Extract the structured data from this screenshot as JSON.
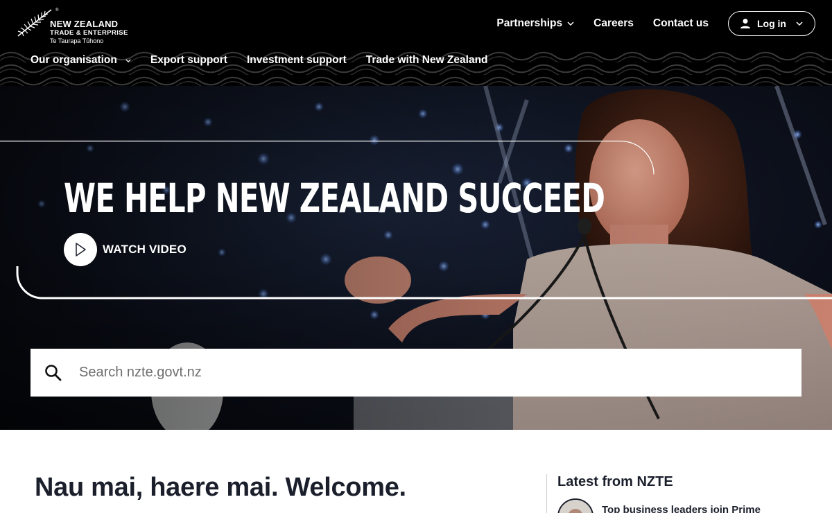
{
  "header": {
    "logo": {
      "line1": "NEW ZEALAND",
      "line2": "TRADE & ENTERPRISE",
      "line3": "Te Taurapa Tūhono",
      "registered": "®"
    },
    "top_nav": [
      {
        "label": "Partnerships",
        "has_dropdown": true
      },
      {
        "label": "Careers",
        "has_dropdown": false
      },
      {
        "label": "Contact us",
        "has_dropdown": false
      }
    ],
    "login": {
      "label": "Log in",
      "icon": "user-icon"
    },
    "sub_nav": [
      {
        "label": "Our organisation",
        "has_dropdown": true
      },
      {
        "label": "Export support",
        "has_dropdown": false
      },
      {
        "label": "Investment support",
        "has_dropdown": false
      },
      {
        "label": "Trade with New Zealand",
        "has_dropdown": false
      }
    ]
  },
  "hero": {
    "title": "WE HELP NEW ZEALAND SUCCEED",
    "watch_label": "WATCH VIDEO",
    "search_placeholder": "Search nzte.govt.nz"
  },
  "main": {
    "welcome": "Nau mai, haere mai. Welcome.",
    "latest": {
      "heading": "Latest from NZTE",
      "items": [
        {
          "title": "Top business leaders join Prime"
        }
      ]
    }
  },
  "colors": {
    "header_bg": "#000000",
    "text_dark": "#1b1f2b",
    "white": "#ffffff"
  }
}
